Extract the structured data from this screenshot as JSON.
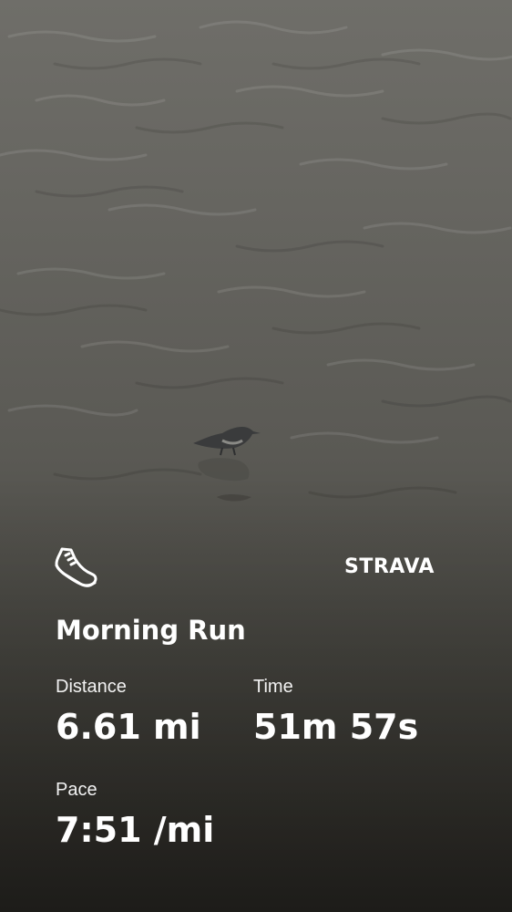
{
  "brand": {
    "name": "STRAVA"
  },
  "activity": {
    "title": "Morning Run",
    "type_icon": "running-shoe-icon"
  },
  "stats": {
    "distance": {
      "label": "Distance",
      "value": "6.61 mi"
    },
    "time": {
      "label": "Time",
      "value": "51m 57s"
    },
    "pace": {
      "label": "Pace",
      "value": "7:51 /mi"
    }
  },
  "colors": {
    "text": "#ffffff",
    "background_water": "#65645f"
  }
}
